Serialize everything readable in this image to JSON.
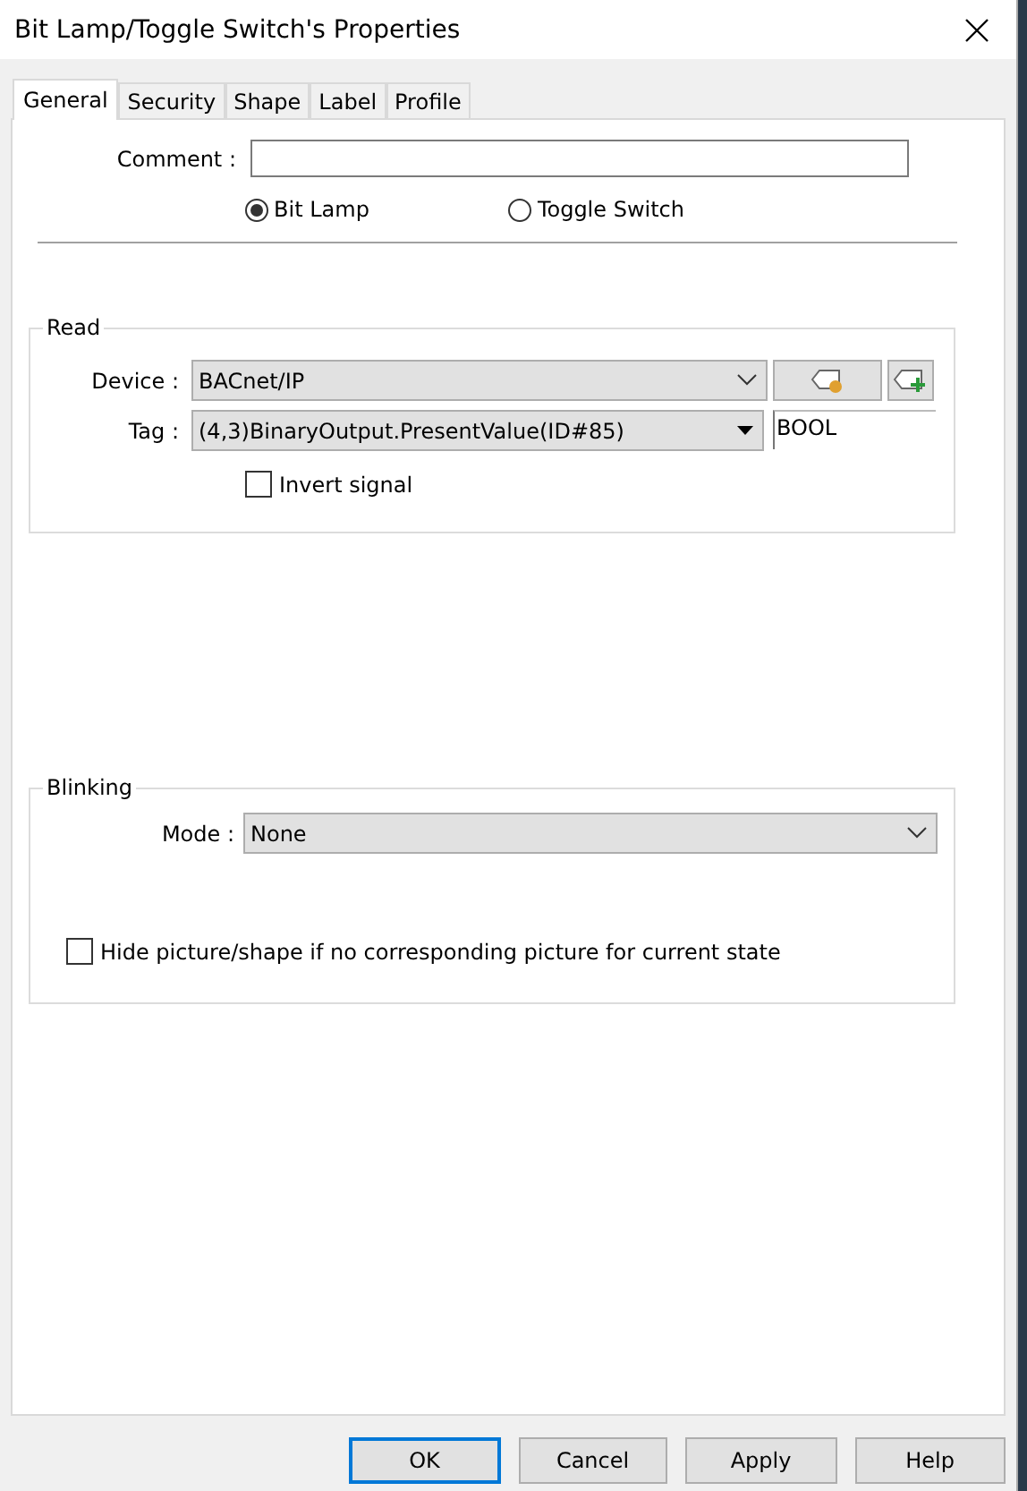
{
  "window": {
    "title": "Bit Lamp/Toggle Switch's Properties"
  },
  "tabs": [
    {
      "label": "General",
      "selected": true
    },
    {
      "label": "Security",
      "selected": false
    },
    {
      "label": "Shape",
      "selected": false
    },
    {
      "label": "Label",
      "selected": false
    },
    {
      "label": "Profile",
      "selected": false
    }
  ],
  "comment": {
    "label": "Comment :"
  },
  "object_types": [
    {
      "label": "Bit Lamp",
      "selected": true
    },
    {
      "label": "Toggle Switch",
      "selected": false
    }
  ],
  "read": {
    "title": "Read",
    "device": {
      "label": "Device :",
      "value": "BACnet/IP"
    },
    "tag": {
      "label": "Tag :",
      "value": "(4,3)BinaryOutput.PresentValue(ID#85)"
    },
    "data_type": "BOOL",
    "invert": {
      "label": "Invert signal",
      "checked": false
    }
  },
  "blinking": {
    "title": "Blinking",
    "mode": {
      "label": "Mode :",
      "value": "None"
    },
    "hide": {
      "label": "Hide picture/shape if no corresponding picture for current state",
      "checked": false
    }
  },
  "buttons": [
    {
      "label": "OK",
      "default": true
    },
    {
      "label": "Cancel",
      "default": false
    },
    {
      "label": "Apply",
      "default": false
    },
    {
      "label": "Help",
      "default": false
    }
  ]
}
